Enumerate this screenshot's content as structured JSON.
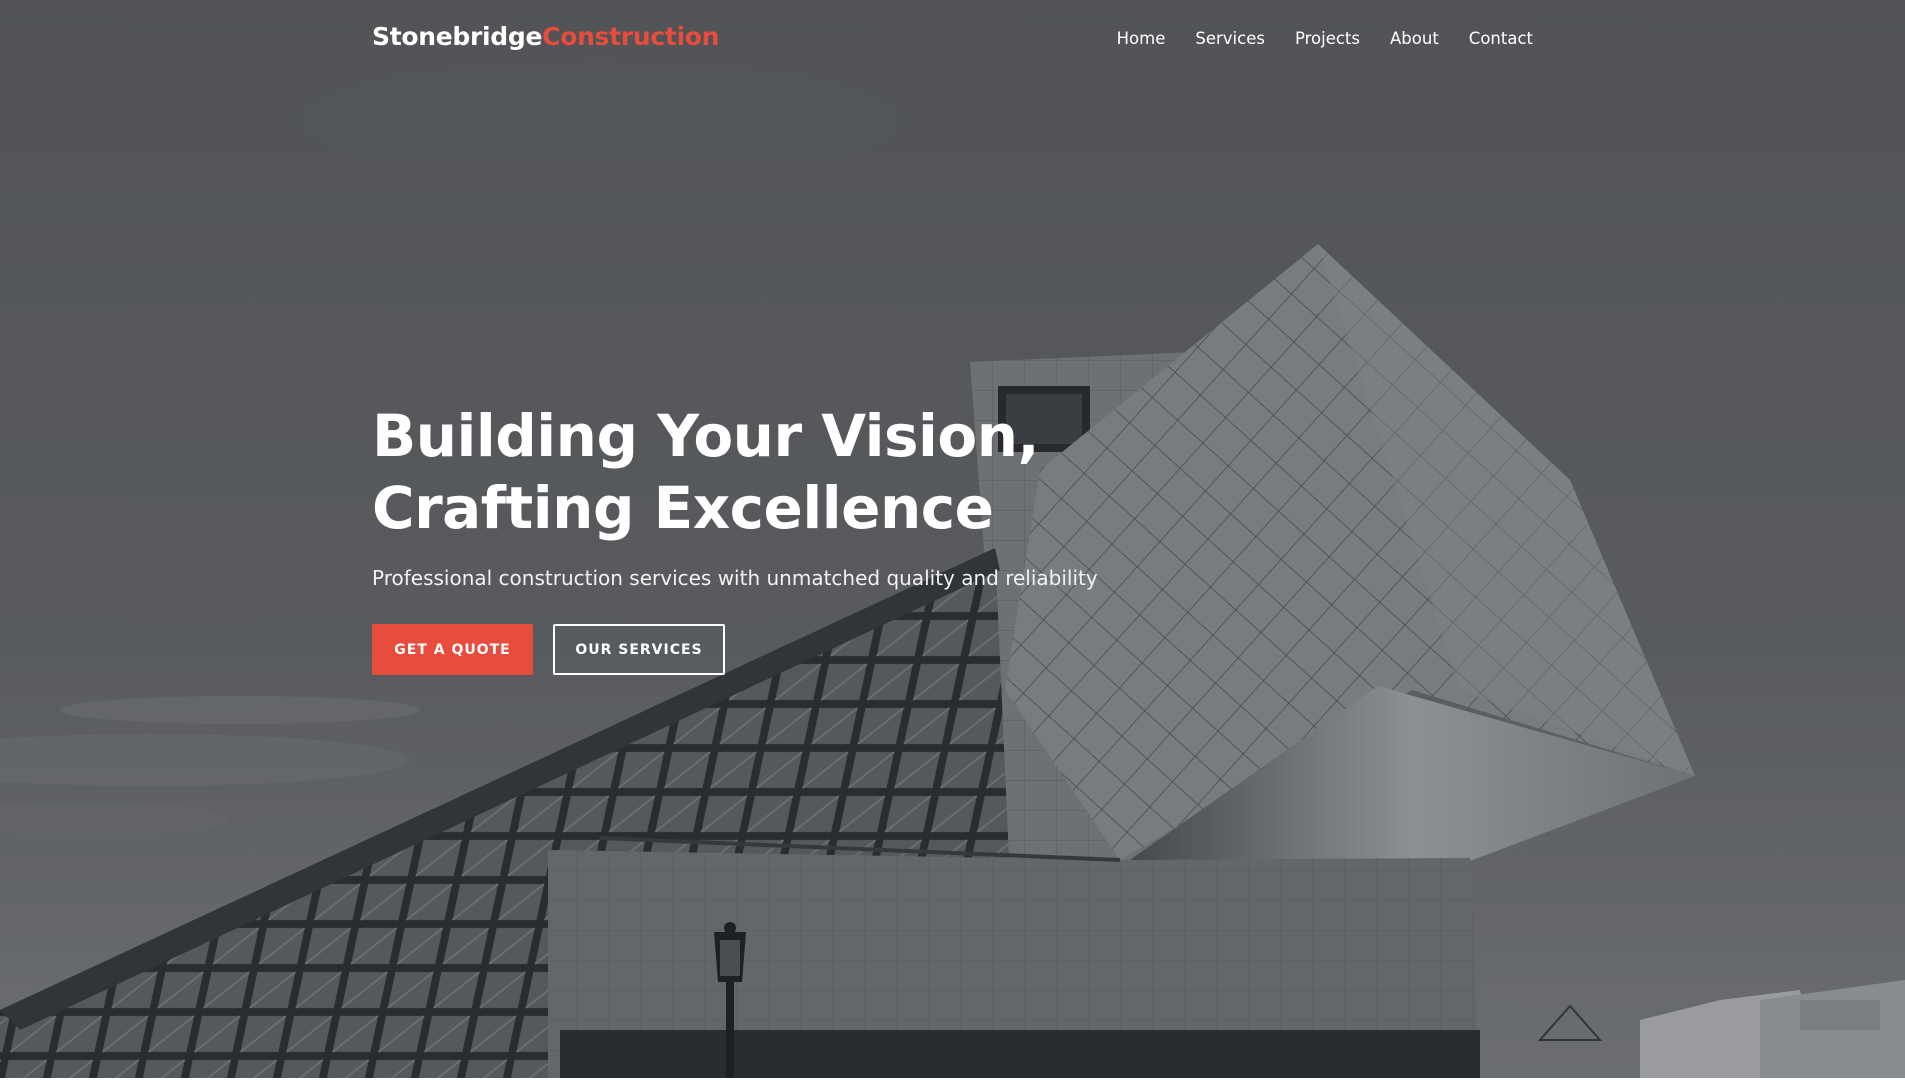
{
  "navbar": {
    "logo": {
      "part1": "Stonebridge",
      "part2": "Construction"
    },
    "links": [
      {
        "label": "Home"
      },
      {
        "label": "Services"
      },
      {
        "label": "Projects"
      },
      {
        "label": "About"
      },
      {
        "label": "Contact"
      }
    ]
  },
  "hero": {
    "title_line1": "Building Your Vision,",
    "title_line2": "Crafting Excellence",
    "subtitle": "Professional construction services with unmatched quality and reliability",
    "primary_button": "GET A QUOTE",
    "secondary_button": "OUR SERVICES"
  },
  "colors": {
    "accent": "#e74c3c",
    "text": "#ffffff",
    "overlay": "#1e2024"
  }
}
